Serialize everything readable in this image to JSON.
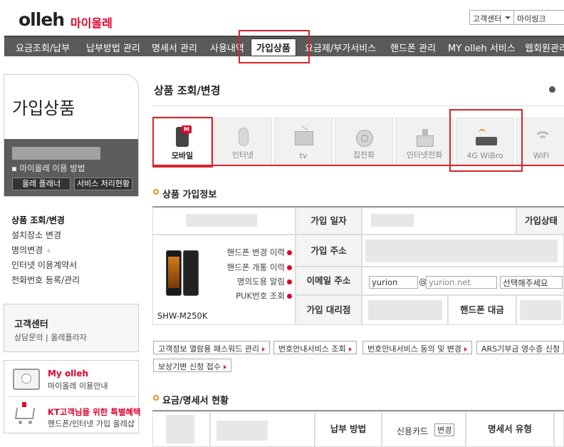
{
  "header": {
    "logo": "olleh",
    "logo_sub": "마이올레",
    "search_select": "고객센터",
    "search_input": "마이씽크"
  },
  "nav": [
    "요금조회/납부",
    "납부방법 관리",
    "명세서 관리",
    "사용내역",
    "가입상품",
    "요금제/부가서비스",
    "핸드폰 관리",
    "MY olleh 서비스",
    "웹회원관리"
  ],
  "sidebar": {
    "title": "가입상품",
    "how_to": "마이올레 이용 방법",
    "btn_planner": "올레 플래너",
    "btn_service": "서비스 처리현황",
    "menu": [
      "상품 조회/변경",
      "설치장소 변경",
      "명의변경",
      "인터넷 이용계약서",
      "전화번호 등록/관리"
    ],
    "cs_title": "고객센터",
    "cs_link1": "상담문의",
    "cs_sep": "|",
    "cs_link2": "올레플라자",
    "myolleh_title": "My olleh",
    "myolleh_sub": "마이올레 이용안내",
    "kt_title": "KT고객님을 위한 특별혜택",
    "kt_sub": "핸드폰/인터넷 가입 올레샵"
  },
  "main": {
    "title": "상품 조회/변경",
    "tabs": [
      "모바일",
      "인터넷",
      "tv",
      "집전화",
      "인터넷전화",
      "4G WiBro",
      "WiFi"
    ],
    "sec1": "상품 가입정보",
    "model": "SHW-M250K",
    "phone_links": [
      "핸드폰 변경 이력",
      "핸드폰 개통 이력",
      "명의도용 알림",
      "PUK번호 조회"
    ],
    "join_date": "가입 일자",
    "join_status": "가입상태",
    "join_addr": "가입 주소",
    "email_label": "이메일 주소",
    "email_user": "yurion",
    "email_at": "@",
    "email_domain": "yurion.net",
    "email_select": "선택해주세요",
    "agency_label": "가입 대리점",
    "phone_price": "핸드폰 대금",
    "btns_row1": [
      "고객정보 열람용 패스워드 관리",
      "번호안내서비스 조회",
      "번호안내서비스 동의 및 변경",
      "ARS기부금 영수증 신청"
    ],
    "btns_row2": [
      "보상기변 신청 접수"
    ],
    "sec2": "요금/명세서 현황",
    "pay_method": "납부 방법",
    "card": "신용카드",
    "change": "변경",
    "bill_type": "명세서 유형"
  },
  "colors": {
    "accent": "#d9232d",
    "nav_bg": "#5a5a5a",
    "orange": "#f08c1e"
  }
}
